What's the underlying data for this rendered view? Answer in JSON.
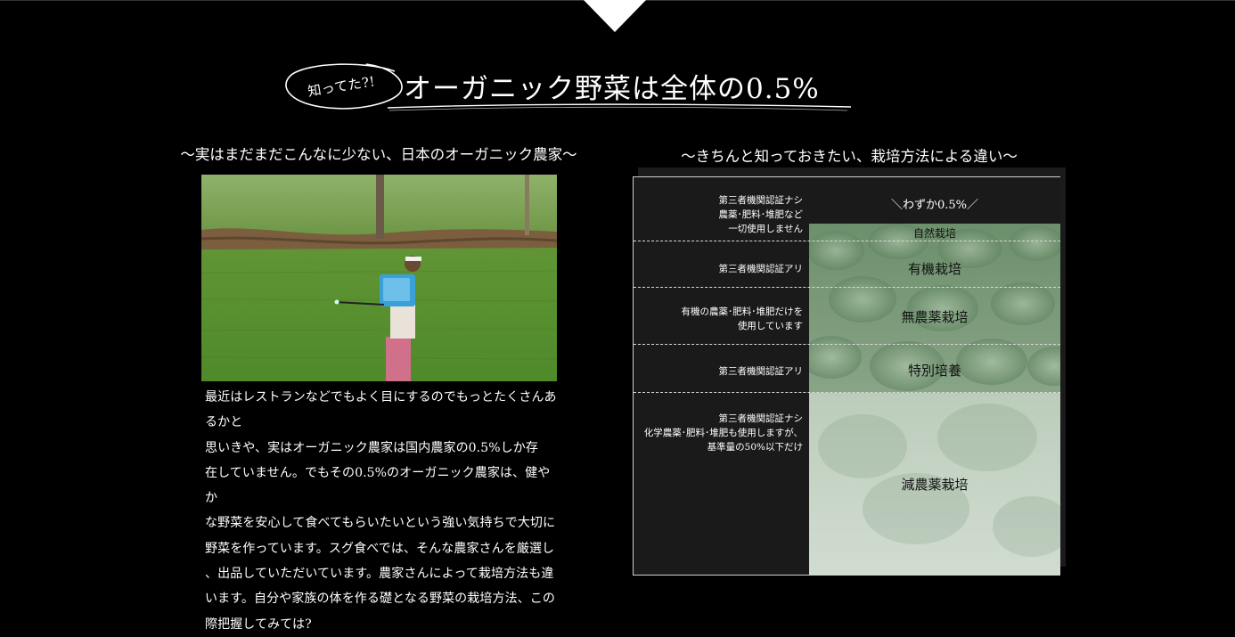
{
  "heading": {
    "badge": "知ってた?!",
    "title": "オーガニック野菜は全体の0.5%"
  },
  "left": {
    "subtitle": "〜実はまだまだこんなに少ない、日本のオーガニック農家〜",
    "paragraph_lines": [
      "最近はレストランなどでもよく目にするのでもっとたくさんあるかと",
      "思いきや、実はオーガニック農家は国内農家の0.5%しか存",
      "在していません。でもその0.5%のオーガニック農家は、健やか",
      "な野菜を安心して食べてもらいたいという強い気持ちで大切に",
      "野菜を作っています。スグ食べでは、そんな農家さんを厳選し",
      "、出品していただいています。農家さんによって栽培方法も違",
      "います。自分や家族の体を作る礎となる野菜の栽培方法、この",
      "際把握してみては?"
    ]
  },
  "right": {
    "subtitle": "〜きちんと知っておきたい、栽培方法による違い〜",
    "banner": "＼わずか0.5%／",
    "rows": [
      {
        "desc": [
          "第三者機関認証ナシ",
          "農薬･肥料･堆肥など",
          "一切使用しません"
        ],
        "method": "自然栽培"
      },
      {
        "desc": [
          "第三者機関認証アリ"
        ],
        "method": "有機栽培"
      },
      {
        "desc": [
          "有機の農薬･肥料･堆肥だけを",
          "使用しています"
        ],
        "method": "無農薬栽培"
      },
      {
        "desc": [
          "第三者機関認証アリ"
        ],
        "method": "特別培養"
      },
      {
        "desc": [
          "第三者機関認証ナシ",
          "化学農薬･肥料･堆肥も使用しますが、",
          "基準量の50%以下だけ"
        ],
        "method": "減農薬栽培"
      }
    ]
  },
  "colors": {
    "background": "#000000",
    "text": "#ffffff",
    "table_dark": "#1a1a1a",
    "veg_green": "#7f9d7e"
  }
}
